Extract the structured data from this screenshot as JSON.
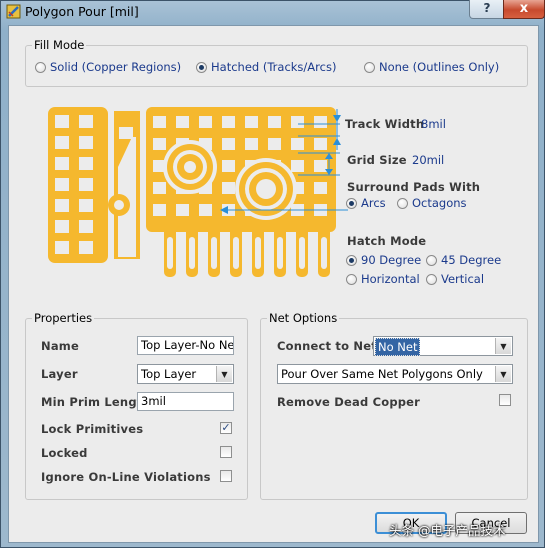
{
  "window": {
    "title": "Polygon Pour [mil]",
    "help_label": "?",
    "close_label": "x"
  },
  "fill_mode": {
    "legend": "Fill Mode",
    "options": [
      {
        "label": "Solid (Copper Regions)",
        "selected": false
      },
      {
        "label": "Hatched (Tracks/Arcs)",
        "selected": true
      },
      {
        "label": "None (Outlines Only)",
        "selected": false
      }
    ]
  },
  "preview": {
    "track_width_label": "Track Width",
    "track_width_value": "8mil",
    "grid_size_label": "Grid Size",
    "grid_size_value": "20mil",
    "surround_label": "Surround Pads With",
    "surround_options": [
      {
        "label": "Arcs",
        "selected": true
      },
      {
        "label": "Octagons",
        "selected": false
      }
    ],
    "hatch_label": "Hatch Mode",
    "hatch_options": [
      {
        "label": "90 Degree",
        "selected": true
      },
      {
        "label": "45 Degree",
        "selected": false
      },
      {
        "label": "Horizontal",
        "selected": false
      },
      {
        "label": "Vertical",
        "selected": false
      }
    ],
    "copper_color": "#f5b82e",
    "dimension_color": "#2b8fd8"
  },
  "properties": {
    "legend": "Properties",
    "name_label": "Name",
    "name_value": "Top Layer-No Net",
    "layer_label": "Layer",
    "layer_value": "Top Layer",
    "min_prim_label": "Min Prim Length",
    "min_prim_value": "3mil",
    "lock_primitives_label": "Lock Primitives",
    "lock_primitives_checked": true,
    "locked_label": "Locked",
    "locked_checked": false,
    "ignore_label": "Ignore On-Line Violations",
    "ignore_checked": false
  },
  "net_options": {
    "legend": "Net Options",
    "connect_label": "Connect to Net",
    "connect_value": "No Net",
    "pour_value": "Pour Over Same Net Polygons Only",
    "remove_dead_label": "Remove Dead Copper",
    "remove_dead_checked": false
  },
  "buttons": {
    "ok": "OK",
    "cancel": "Cancel"
  },
  "watermark": "头条 @电子产品技术"
}
